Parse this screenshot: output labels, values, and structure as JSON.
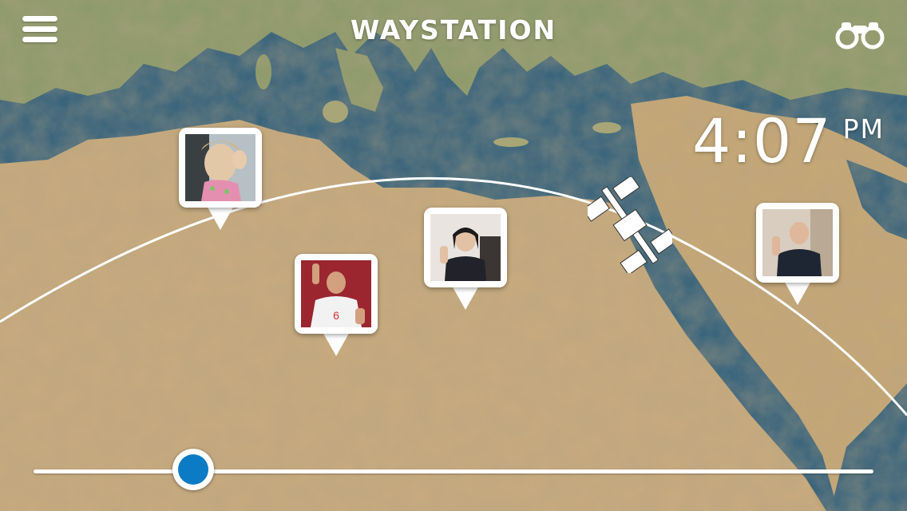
{
  "app": {
    "title": "WAYSTATION"
  },
  "header": {
    "menu_icon": "hamburger-menu-icon",
    "binoculars_icon": "binoculars-icon"
  },
  "clock": {
    "time": "4:07",
    "ampm": "PM"
  },
  "map": {
    "land_color": "#c9ab7e",
    "sea_color": "#2f5f7c",
    "orbit_color": "#ffffff"
  },
  "station": {
    "icon": "space-station-icon"
  },
  "pins": [
    {
      "name": "girl-waving",
      "photo": "child in pink floral outfit waving"
    },
    {
      "name": "footballer-waving",
      "photo": "man in white football jersey number 6 waving"
    },
    {
      "name": "woman-waving",
      "photo": "woman in dark jacket waving"
    },
    {
      "name": "man-waving",
      "photo": "older man in dark sweater waving"
    }
  ],
  "timeline": {
    "progress": 0.19,
    "accent": "#0b7bc5"
  }
}
